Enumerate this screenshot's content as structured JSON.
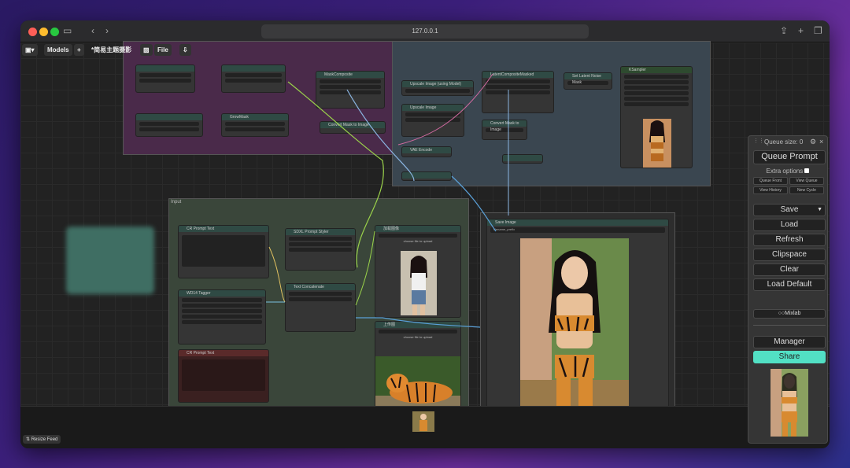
{
  "browser": {
    "url": "127.0.0.1"
  },
  "menubar": {
    "models": "Models",
    "add": "+",
    "title": "*简易主题摄影",
    "file": "File"
  },
  "groups": {
    "input": "Input"
  },
  "nodes": {
    "clip_prompt_text": "CR Prompt Text",
    "sdxl_prompt_styler": "SDXL Prompt Styler",
    "wd14_tagger": "WD14 Tagger",
    "text_concatenate": "Text Concatenate",
    "cr_prompt_text2": "CR Prompt Text",
    "load_image1": "加载图像",
    "load_image2": "上传图",
    "save_image": "Save Image",
    "mask_composite": "MaskComposite",
    "upscale_image": "Upscale Image",
    "vae_encode": "VAE Encode",
    "latent_composite": "LatentCompositeMasked",
    "convert_mask": "Convert Mask to Image",
    "grow_mask": "GrowMask",
    "set_latent_noise": "Set Latent Noise Mask",
    "image_scale": "Upscale Image (using Model)",
    "ksampler": "KSampler",
    "choose_file": "choose file to upload",
    "save_prefix": "filename_prefix"
  },
  "panel": {
    "queue_size": "Queue size: 0",
    "queue_prompt": "Queue Prompt",
    "extra_options": "Extra options",
    "queue_front": "Queue Front",
    "view_queue": "View Queue",
    "view_history": "View History",
    "new_cycle": "New Cycle",
    "save": "Save",
    "load": "Load",
    "refresh": "Refresh",
    "clipspace": "Clipspace",
    "clear": "Clear",
    "load_default": "Load Default",
    "mixlab": "Mixlab",
    "manager": "Manager",
    "share": "Share"
  },
  "feed": {
    "resize": "Resize Feed"
  },
  "colors": {
    "share": "#52e0c4",
    "group_purple": "#5a2a5a",
    "group_input": "#3a4a3a",
    "group_blue": "#3a4a5a"
  }
}
